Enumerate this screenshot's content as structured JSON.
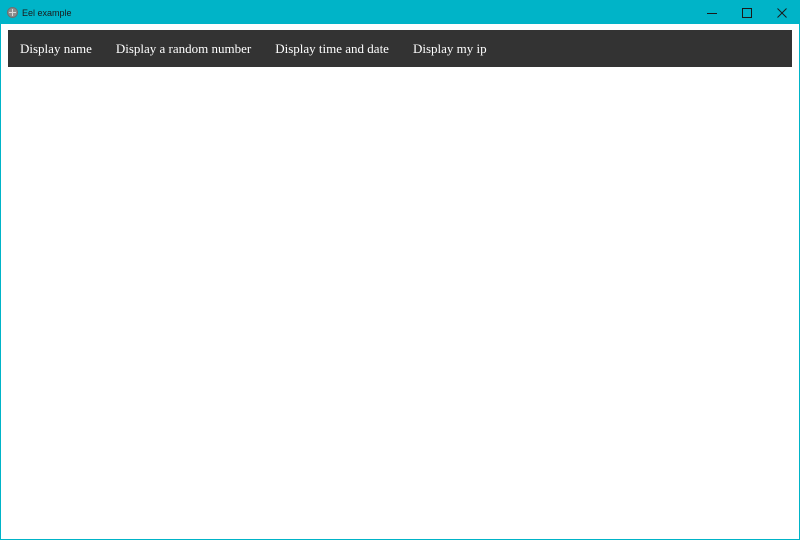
{
  "window": {
    "title": "Eel example",
    "accent_color": "#00b4c8",
    "controls": [
      {
        "icon": "minimize-icon"
      },
      {
        "icon": "maximize-icon"
      },
      {
        "icon": "close-icon"
      }
    ]
  },
  "navbar": {
    "background": "#333333",
    "items": [
      {
        "label": "Display name"
      },
      {
        "label": "Display a random number"
      },
      {
        "label": "Display time and date"
      },
      {
        "label": "Display my ip"
      }
    ]
  }
}
